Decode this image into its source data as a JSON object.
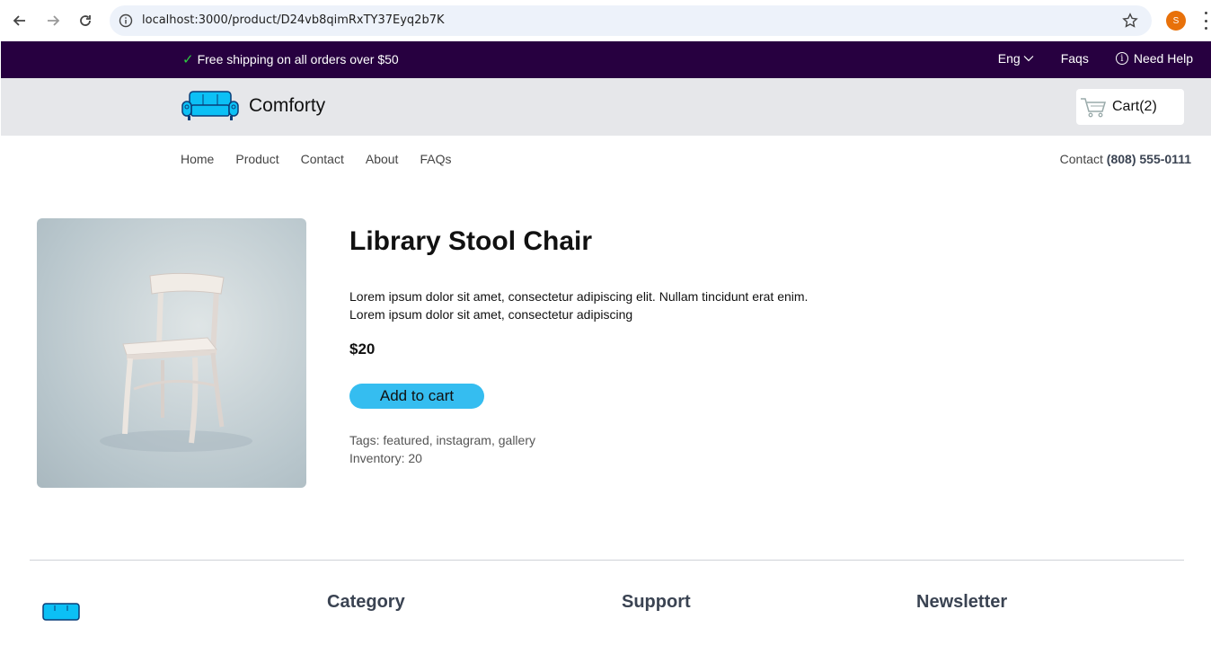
{
  "browser": {
    "url": "localhost:3000/product/D24vb8qimRxTY37Eyq2b7K",
    "profile_initial": "S"
  },
  "topbar": {
    "shipping_text": "Free shipping on all orders over $50",
    "language": "Eng",
    "faqs": "Faqs",
    "need_help": "Need Help"
  },
  "header": {
    "brand": "Comforty",
    "cart_label": "Cart(2)"
  },
  "nav": {
    "items": [
      "Home",
      "Product",
      "Contact",
      "About",
      "FAQs"
    ],
    "contact_label": "Contact",
    "contact_phone": "(808) 555-0111"
  },
  "product": {
    "title": "Library Stool Chair",
    "description_line1": "Lorem ipsum dolor sit amet, consectetur adipiscing elit. Nullam tincidunt erat enim.",
    "description_line2": "Lorem ipsum dolor sit amet, consectetur adipiscing",
    "price": "$20",
    "add_to_cart": "Add to cart",
    "tags": "Tags: featured, instagram, gallery",
    "inventory": "Inventory: 20"
  },
  "footer": {
    "col_category": "Category",
    "col_support": "Support",
    "col_newsletter": "Newsletter"
  },
  "colors": {
    "topbar_bg": "#270040",
    "header_bg": "#e6e7ea",
    "accent": "#35bdf0"
  }
}
